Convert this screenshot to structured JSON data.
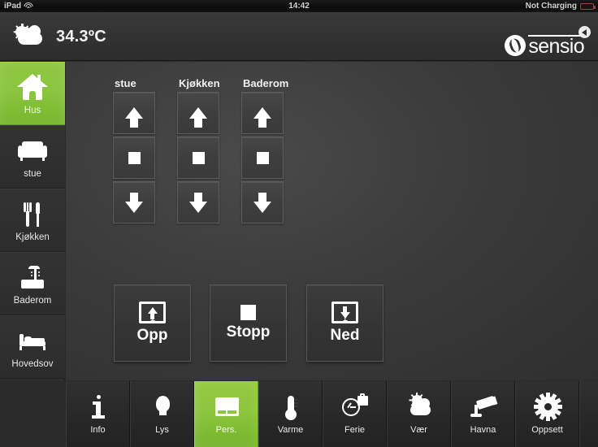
{
  "statusbar": {
    "device": "iPad",
    "wifi_icon": "wifi-icon",
    "time": "14:42",
    "battery_text": "Not Charging",
    "battery_icon": "battery-icon"
  },
  "header": {
    "weather_icon": "sun-behind-cloud-icon",
    "temperature": "34.3ºC",
    "logo_text": "sensio",
    "logo_mark": "sensio-s-logo-icon",
    "back_button_icon": "back-arrow-icon"
  },
  "sidebar": {
    "items": [
      {
        "label": "Hus",
        "icon": "house-icon",
        "active": true
      },
      {
        "label": "stue",
        "icon": "sofa-icon",
        "active": false
      },
      {
        "label": "Kjøkken",
        "icon": "cutlery-icon",
        "active": false
      },
      {
        "label": "Baderom",
        "icon": "shower-icon",
        "active": false
      },
      {
        "label": "Hovedsov",
        "icon": "bed-icon",
        "active": false
      }
    ]
  },
  "main": {
    "columns": [
      {
        "title": "stue",
        "up": "arrow-up-icon",
        "stop": "stop-square-icon",
        "down": "arrow-down-icon"
      },
      {
        "title": "Kjøkken",
        "up": "arrow-up-icon",
        "stop": "stop-square-icon",
        "down": "arrow-down-icon"
      },
      {
        "title": "Baderom",
        "up": "arrow-up-icon",
        "stop": "stop-square-icon",
        "down": "arrow-down-icon"
      }
    ],
    "master_buttons": [
      {
        "label": "Opp",
        "icon": "blind-up-icon"
      },
      {
        "label": "Stopp",
        "icon": "stop-square-icon"
      },
      {
        "label": "Ned",
        "icon": "blind-down-icon"
      }
    ]
  },
  "bottomnav": {
    "tabs": [
      {
        "label": "Info",
        "icon": "info-icon",
        "active": false
      },
      {
        "label": "Lys",
        "icon": "lightbulb-icon",
        "active": false
      },
      {
        "label": "Pers.",
        "icon": "blinds-icon",
        "active": true
      },
      {
        "label": "Varme",
        "icon": "thermometer-icon",
        "active": false
      },
      {
        "label": "Ferie",
        "icon": "clock-suitcase-icon",
        "active": false
      },
      {
        "label": "Vær",
        "icon": "sun-cloud-icon",
        "active": false
      },
      {
        "label": "Havna",
        "icon": "camera-icon",
        "active": false
      },
      {
        "label": "Oppsett",
        "icon": "gear-icon",
        "active": false
      }
    ]
  },
  "colors": {
    "accent_green": "#8cc63f",
    "accent_green_dark": "#74b42a",
    "panel_dark": "#2e2e2e",
    "content_grey": "#3c3c3c",
    "text_light": "#ffffff"
  }
}
